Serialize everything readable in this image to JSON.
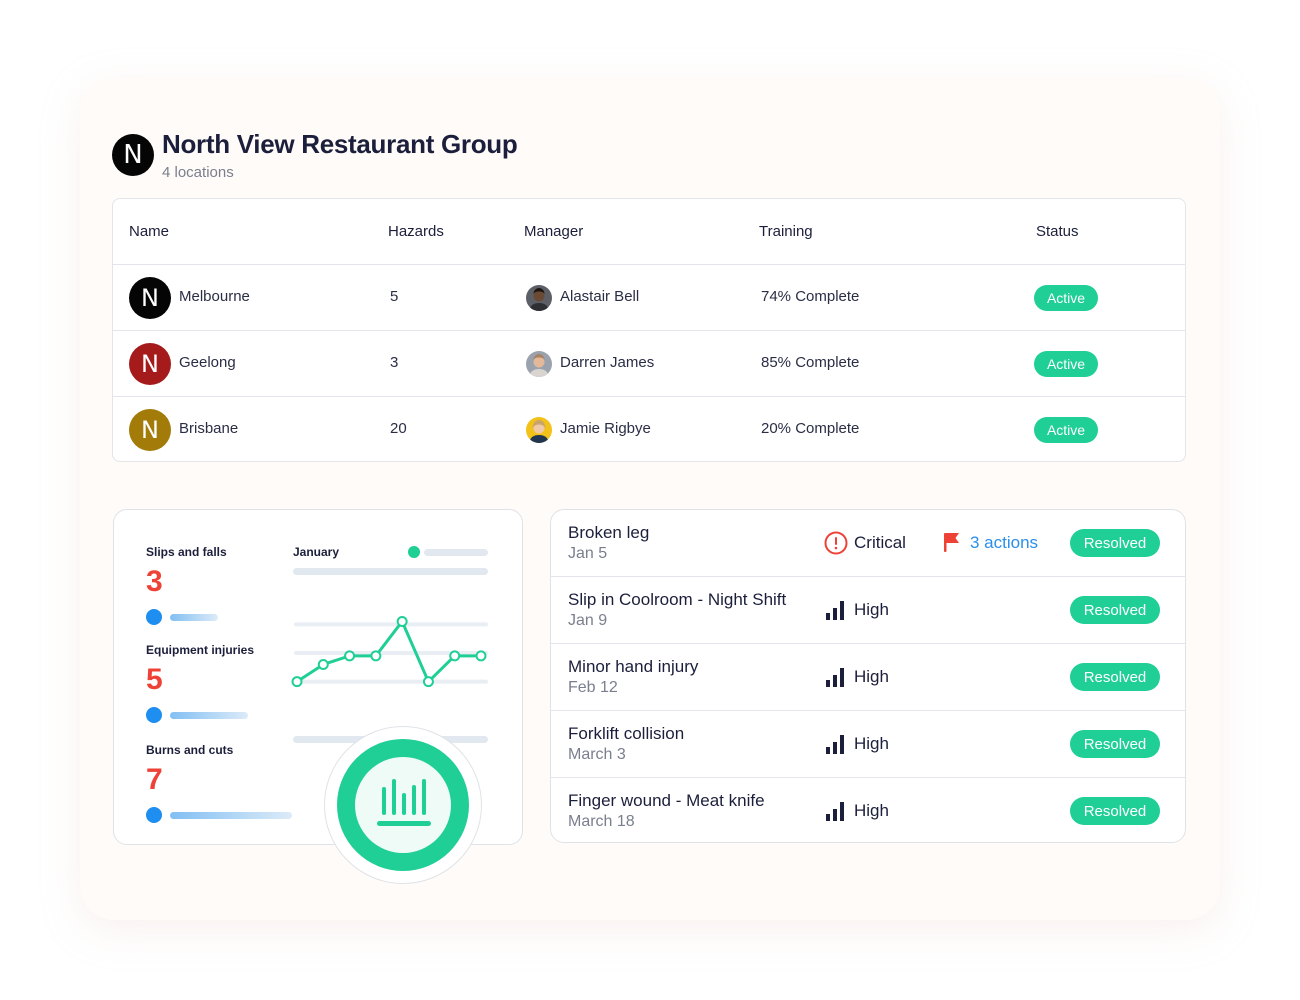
{
  "org": {
    "initial": "N",
    "title": "North View Restaurant Group",
    "subtitle": "4 locations"
  },
  "table": {
    "columns": [
      "Name",
      "Hazards",
      "Manager",
      "Training",
      "Status"
    ],
    "rows": [
      {
        "initial": "N",
        "logo_color": "#050505",
        "name": "Melbourne",
        "hazards": "5",
        "manager": "Alastair Bell",
        "training": "74% Complete",
        "status": "Active"
      },
      {
        "initial": "N",
        "logo_color": "#a51b1b",
        "name": "Geelong",
        "hazards": "3",
        "manager": "Darren James",
        "training": "85% Complete",
        "status": "Active"
      },
      {
        "initial": "N",
        "logo_color": "#a27b08",
        "name": "Brisbane",
        "hazards": "20",
        "manager": "Jamie Rigbye",
        "training": "20% Complete",
        "status": "Active"
      }
    ]
  },
  "stats": {
    "items": [
      {
        "label": "Slips and falls",
        "value": "3"
      },
      {
        "label": "Equipment injuries",
        "value": "5"
      },
      {
        "label": "Burns and cuts",
        "value": "7"
      }
    ],
    "chart_label": "January"
  },
  "chart_data": {
    "type": "line",
    "title": "",
    "legend": "January",
    "x": [
      1,
      2,
      3,
      4,
      5,
      6,
      7,
      8
    ],
    "values": [
      1,
      2.2,
      2.8,
      2.8,
      5.2,
      1,
      2.8,
      2.8
    ],
    "ylim": [
      0,
      6
    ],
    "grid": true,
    "color": "#1fcf95"
  },
  "incidents": [
    {
      "title": "Broken leg",
      "date": "Jan 5",
      "severity": "Critical",
      "severity_icon": "alert-circle-icon",
      "actions": "3 actions",
      "status": "Resolved"
    },
    {
      "title": "Slip in Coolroom - Night Shift",
      "date": "Jan 9",
      "severity": "High",
      "severity_icon": "signal-bars-icon",
      "actions": "",
      "status": "Resolved"
    },
    {
      "title": "Minor hand injury",
      "date": "Feb 12",
      "severity": "High",
      "severity_icon": "signal-bars-icon",
      "actions": "",
      "status": "Resolved"
    },
    {
      "title": "Forklift collision",
      "date": "March 3",
      "severity": "High",
      "severity_icon": "signal-bars-icon",
      "actions": "",
      "status": "Resolved"
    },
    {
      "title": "Finger wound - Meat knife",
      "date": "March 18",
      "severity": "High",
      "severity_icon": "signal-bars-icon",
      "actions": "",
      "status": "Resolved"
    }
  ],
  "colors": {
    "accent_green": "#1fcf95",
    "critical_red": "#ee4237",
    "link_blue": "#2a8fe8",
    "text_dark": "#1b1f3b"
  }
}
